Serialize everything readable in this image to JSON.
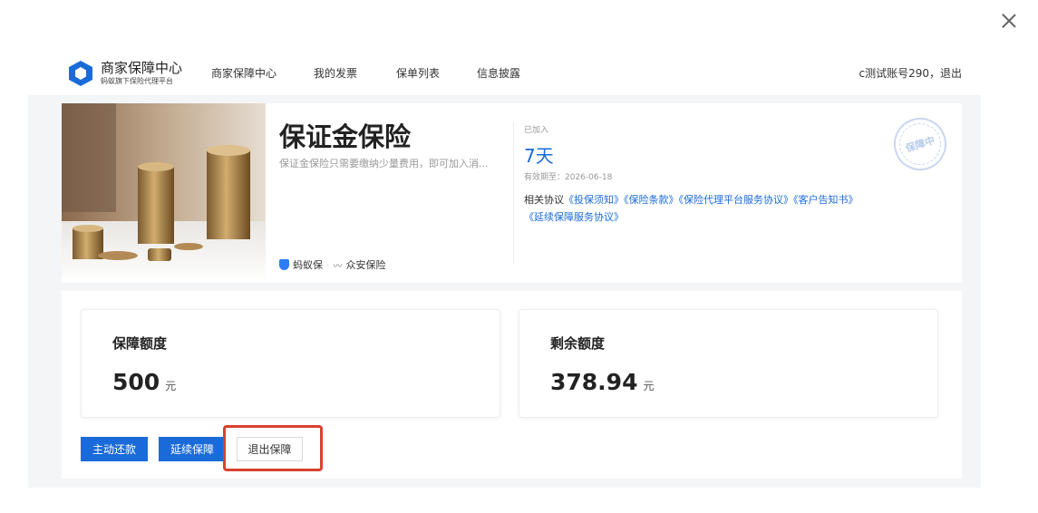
{
  "window": {
    "close_icon": "close-icon"
  },
  "nav": {
    "brand_title": "商家保障中心",
    "brand_subtitle": "蚂蚁旗下保险代理平台",
    "items": [
      "商家保障中心",
      "我的发票",
      "保单列表",
      "信息披露"
    ],
    "account": "c测试账号290，退出"
  },
  "product": {
    "title": "保证金保险",
    "description": "保证金保险只需要缴纳少量费用，即可加入消...",
    "provider_1": "蚂蚁保",
    "provider_sep": "·",
    "provider_2": "众安保险",
    "joined_label": "已加入",
    "days": "7天",
    "valid_until": "有效期至：2026-06-18",
    "agreements_label": "相关协议",
    "agreements": [
      "《投保须知》",
      "《保险条款》",
      "《保险代理平台服务协议》",
      "《客户告知书》",
      "《延续保障服务协议》"
    ],
    "stamp_text": "保障中"
  },
  "quota": {
    "coverage_label": "保障额度",
    "coverage_value": "500",
    "coverage_unit": "元",
    "remaining_label": "剩余额度",
    "remaining_value": "378.94",
    "remaining_unit": "元"
  },
  "actions": {
    "repay": "主动还款",
    "extend": "延续保障",
    "exit": "退出保障"
  },
  "colors": {
    "accent": "#1a6bd9",
    "highlight": "#d9412f",
    "background": "#f4f5f7"
  }
}
